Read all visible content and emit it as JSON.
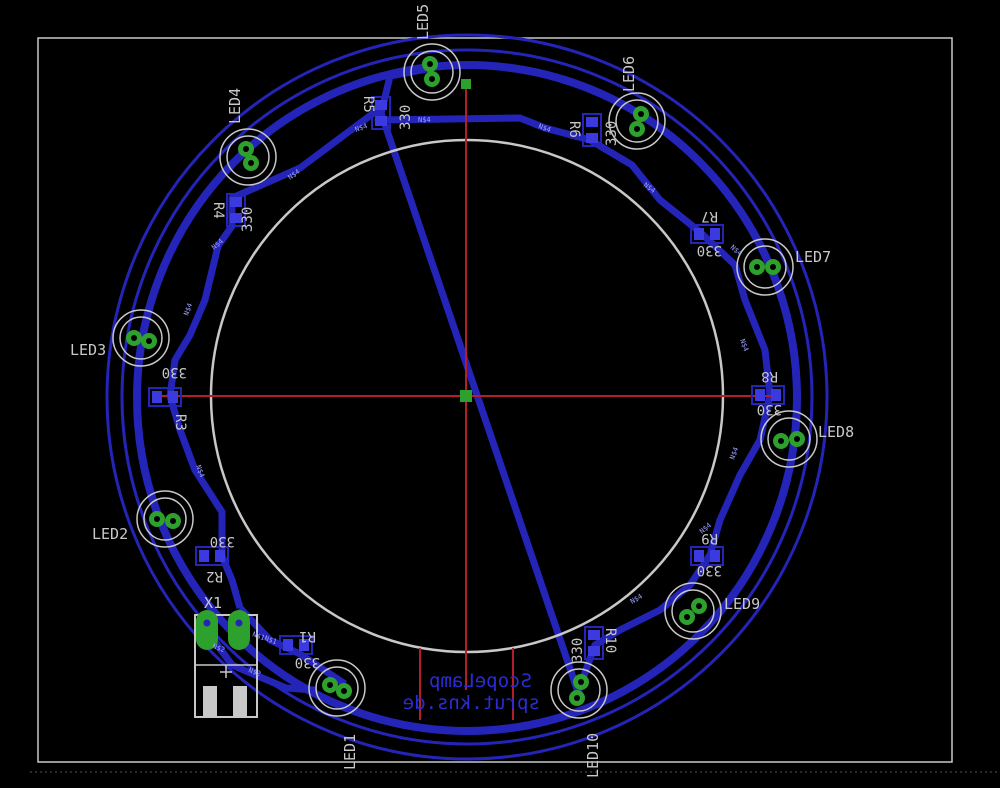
{
  "labels": {
    "led1": "LED1",
    "led2": "LED2",
    "led3": "LED3",
    "led4": "LED4",
    "led5": "LED5",
    "led6": "LED6",
    "led7": "LED7",
    "led8": "LED8",
    "led9": "LED9",
    "led10": "LED10",
    "r1": "R1",
    "r2": "R2",
    "r3": "R3",
    "r4": "R4",
    "r5": "R5",
    "r6": "R6",
    "r7": "R7",
    "r8": "R8",
    "r9": "R9",
    "r10": "R10",
    "value": "330",
    "x1": "X1",
    "net": "N$4",
    "net1": "N$1",
    "net2": "N$2",
    "brand_line1": "ScopeLamp",
    "brand_line2": "sprut.kns.de"
  },
  "colors": {
    "background": "#000000",
    "board_outline": "#c8c8c8",
    "trace": "#2424b8",
    "pad": "#20a020",
    "center_line": "#b41e28",
    "silkscreen": "#c8c8c8",
    "text_bottom": "#2b2bd8"
  }
}
